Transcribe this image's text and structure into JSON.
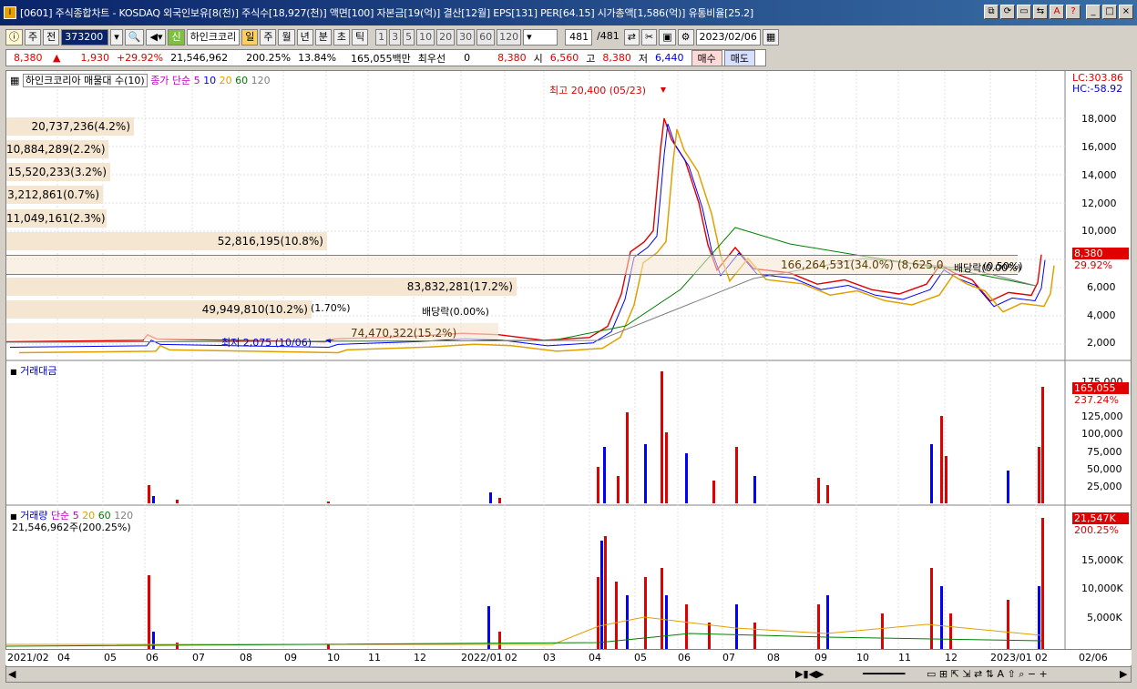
{
  "titlebar": {
    "icon": "app-icon",
    "text": "[0601] 주식종합차트 - KOSDAQ 외국인보유[8(천)] 주식수[18,927(천)] 액면[100] 자본금[19(억)] 결산[12월] EPS[131] PER[64.15] 시가총액[1,586(억)] 유통비율[25.2]",
    "buttons": [
      "⧉",
      "⟳",
      "▭",
      "⇆",
      "A",
      "?",
      "_",
      "□",
      "×"
    ]
  },
  "toolbar1": {
    "mode": "주",
    "prev": "전",
    "code": "373200",
    "stock_badge": "신",
    "stock_name": "하인크코리",
    "periods": [
      "일",
      "주",
      "월",
      "년",
      "분",
      "초",
      "틱"
    ],
    "active_period": "일",
    "intervals": [
      "1",
      "3",
      "5",
      "10",
      "20",
      "30",
      "60",
      "120"
    ],
    "count_shown": "481",
    "count_total": "/481",
    "date": "2023/02/06"
  },
  "quote": {
    "price": "8,380",
    "arrow": "▲",
    "change": "1,930",
    "change_pct": "+29.92%",
    "volume": "21,546,962",
    "vol_ratio": "200.25%",
    "turnover": "13.84%",
    "amount": "165,055백만",
    "pref_label": "최우선",
    "pref_value": "0",
    "ask": "8,380",
    "open_label": "시",
    "open": "6,560",
    "high_label": "고",
    "high": "8,380",
    "low_label": "저",
    "low": "6,440",
    "buy": "매수",
    "sell": "매도"
  },
  "price_panel": {
    "legend_name": "하인크코리아 매물대 수(10)",
    "legend_ma": "종가 단순",
    "ma": [
      "5",
      "10",
      "20",
      "60",
      "120"
    ],
    "ma_colors": [
      "#c000c0",
      "#0000ff",
      "#e0a000",
      "#008000",
      "#808080"
    ],
    "lc": "LC:303.86",
    "hc": "HC:-58.92",
    "high_marker": "최고 20,400 (05/23)",
    "low_marker": "최저 2,075 (10/06)",
    "div1": "(1.70%)",
    "div2": "배당락(0.00%)",
    "div3": "배당락(0.00%)",
    "cur_price": "8,380",
    "cur_pct": "29.92%",
    "y_ticks": [
      "18,000",
      "16,000",
      "14,000",
      "12,000",
      "10,000",
      "8,000",
      "6,000",
      "4,000",
      "2,000"
    ],
    "volume_profile": [
      "20,737,236(4.2%)",
      "10,884,289(2.2%)",
      "15,520,233(3.2%)",
      "3,212,861(0.7%)",
      "11,049,161(2.3%)",
      "52,816,195(10.8%)",
      "166,264,531(34.0%)",
      "83,832,281(17.2%)",
      "49,949,810(10.2%)",
      "74,470,322(15.2%)"
    ],
    "profile_extra": "(8,625,0",
    "profile_extra_b": "(0.50%)"
  },
  "amount_panel": {
    "legend": "거래대금",
    "y_ticks": [
      "175,000",
      "150,000",
      "125,000",
      "100,000",
      "75,000",
      "50,000",
      "25,000"
    ],
    "cur": "165,055",
    "cur_pct": "237.24%"
  },
  "volume_panel": {
    "legend": "거래량",
    "legend_ma": "단순",
    "ma": [
      "5",
      "20",
      "60",
      "120"
    ],
    "sub": "21,546,962주(200.25%)",
    "y_ticks": [
      "15,000K",
      "10,000K",
      "5,000K"
    ],
    "cur": "21,547K",
    "cur_pct": "200.25%"
  },
  "x_axis": [
    "2021/02",
    "04",
    "05",
    "06",
    "07",
    "08",
    "09",
    "10",
    "11",
    "12",
    "2022/01",
    "02",
    "03",
    "04",
    "05",
    "06",
    "07",
    "08",
    "09",
    "10",
    "11",
    "12",
    "2023/01",
    "02",
    "02/06"
  ],
  "colors": {
    "up": "#ff0000",
    "down": "#0000ff",
    "profile": "#f5e6d2"
  }
}
